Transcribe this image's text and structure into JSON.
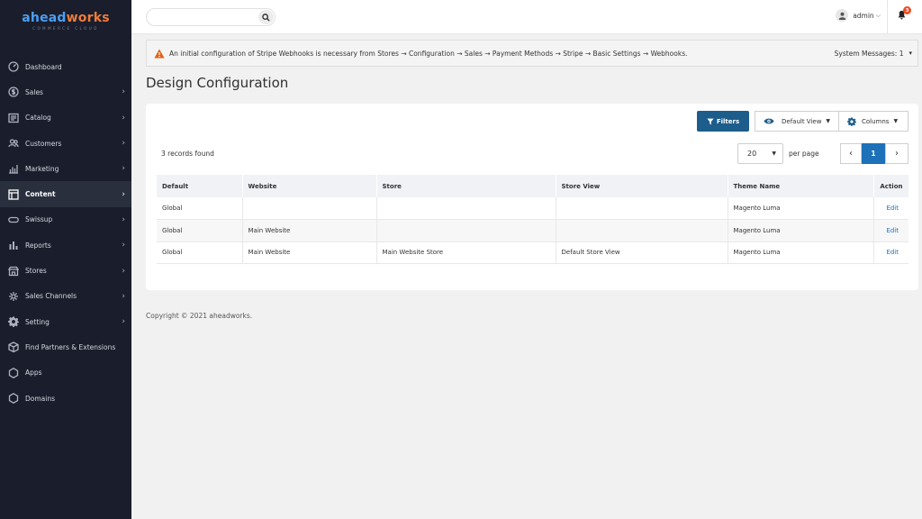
{
  "logo": {
    "part1": "ahead",
    "part2": "works",
    "tagline": "COMMERCE CLOUD"
  },
  "sidebar": {
    "items": [
      {
        "label": "Dashboard",
        "icon": "dashboard-icon",
        "chevron": false
      },
      {
        "label": "Sales",
        "icon": "dollar-icon",
        "chevron": true
      },
      {
        "label": "Catalog",
        "icon": "catalog-icon",
        "chevron": true
      },
      {
        "label": "Customers",
        "icon": "customers-icon",
        "chevron": true
      },
      {
        "label": "Marketing",
        "icon": "marketing-icon",
        "chevron": true
      },
      {
        "label": "Content",
        "icon": "content-icon",
        "chevron": true,
        "active": true
      },
      {
        "label": "Swissup",
        "icon": "swissup-icon",
        "chevron": true
      },
      {
        "label": "Reports",
        "icon": "reports-icon",
        "chevron": true
      },
      {
        "label": "Stores",
        "icon": "stores-icon",
        "chevron": true
      },
      {
        "label": "Sales Channels",
        "icon": "sales-channels-icon",
        "chevron": true
      },
      {
        "label": "Setting",
        "icon": "gear-icon",
        "chevron": true
      },
      {
        "label": "Find Partners & Extensions",
        "icon": "box-icon",
        "chevron": false
      },
      {
        "label": "Apps",
        "icon": "hexagon-icon",
        "chevron": false
      },
      {
        "label": "Domains",
        "icon": "hexagon-icon",
        "chevron": false
      }
    ]
  },
  "header": {
    "search_placeholder": "",
    "user_name": "admin",
    "notification_count": "3"
  },
  "message": {
    "text": "An initial configuration of Stripe Webhooks is necessary from Stores → Configuration → Sales → Payment Methods → Stripe → Basic Settings → Webhooks.",
    "system_messages": "System Messages: 1"
  },
  "page": {
    "title": "Design Configuration"
  },
  "toolbar": {
    "filters_label": "Filters",
    "view_label": "Default View",
    "columns_label": "Columns",
    "records_found": "3 records found",
    "per_page_value": "20",
    "per_page_label": "per page",
    "current_page": "1"
  },
  "table": {
    "headers": [
      "Default",
      "Website",
      "Store",
      "Store View",
      "Theme Name",
      "Action"
    ],
    "rows": [
      [
        "Global",
        "",
        "",
        "",
        "Magento Luma",
        "Edit"
      ],
      [
        "Global",
        "Main Website",
        "",
        "",
        "Magento Luma",
        "Edit"
      ],
      [
        "Global",
        "Main Website",
        "Main Website Store",
        "Default Store View",
        "Magento Luma",
        "Edit"
      ]
    ]
  },
  "footer": {
    "copyright": "Copyright © 2021 aheadworks."
  },
  "colors": {
    "sidebar_bg": "#1a1e2c",
    "primary_button": "#1d5d8c",
    "link": "#1d71b8",
    "notification_badge": "#f04e23",
    "warning": "#e0631b"
  }
}
